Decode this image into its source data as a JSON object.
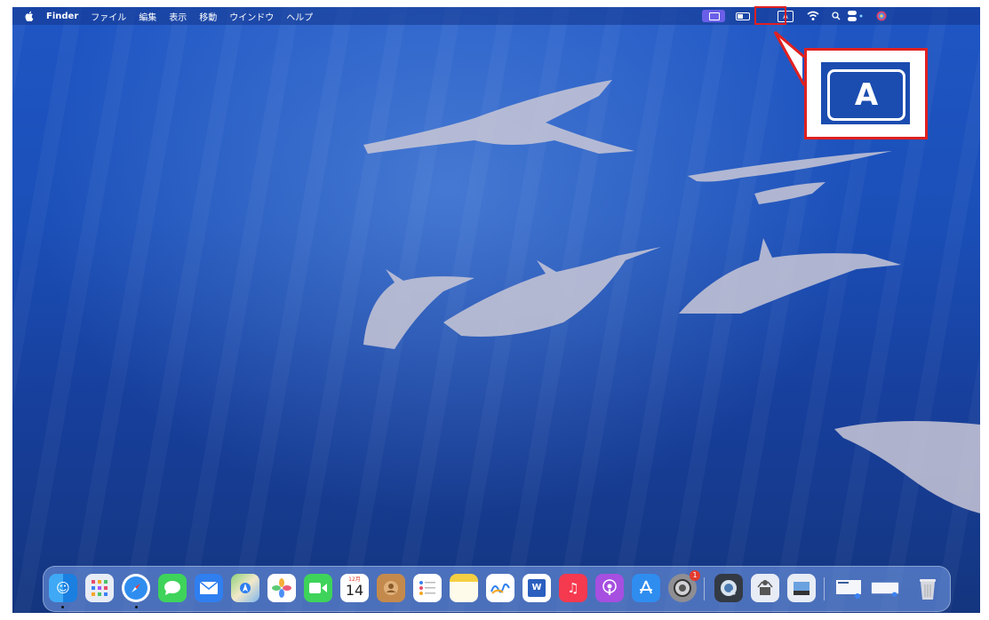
{
  "menubar": {
    "app_name": "Finder",
    "items": [
      "ファイル",
      "編集",
      "表示",
      "移動",
      "ウインドウ",
      "ヘルプ"
    ],
    "input_source_label": "A"
  },
  "callout": {
    "label": "A"
  },
  "dock": {
    "calendar": {
      "month": "12月",
      "day": "14"
    },
    "settings_badge": "1"
  },
  "colors": {
    "highlight": "#e02020",
    "wallpaper": "#1b4fb8",
    "control_center_button": "#6a5fe8"
  },
  "icons": [
    "apple-icon",
    "control-center-icon",
    "battery-icon",
    "input-source-icon",
    "wifi-icon",
    "search-icon",
    "control-toggle-icon",
    "siri-icon"
  ]
}
